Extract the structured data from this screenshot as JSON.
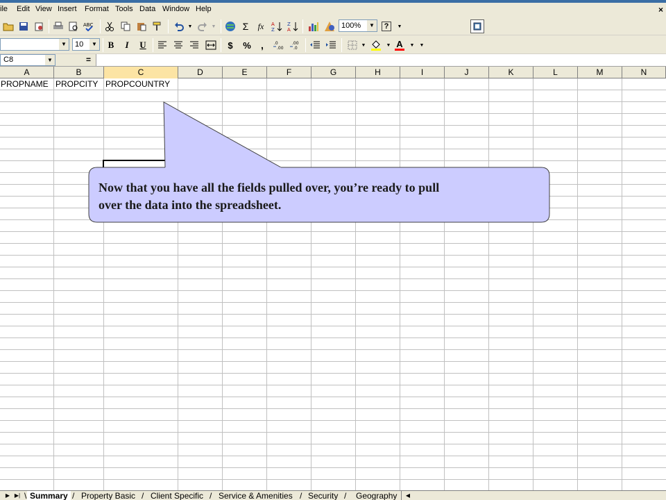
{
  "menubar": {
    "items": [
      {
        "pre": "",
        "u": "F",
        "post": "ile",
        "display": "ile"
      },
      {
        "label": "Edit"
      },
      {
        "label": "View"
      },
      {
        "label": "Insert"
      },
      {
        "label": "Format"
      },
      {
        "label": "Tools"
      },
      {
        "label": "Data"
      },
      {
        "label": "Window"
      },
      {
        "label": "Help"
      }
    ],
    "close_label": "×"
  },
  "toolbar1": {
    "zoom": "100%",
    "help_label": "?"
  },
  "toolbar2": {
    "font_size": "10",
    "bold_label": "B",
    "italic_label": "I",
    "underline_label": "U",
    "currency_label": "$",
    "percent_label": "%",
    "comma_label": ",",
    "font_color_label": "A",
    "fill_color": "#ffff00",
    "font_color": "#ff0000"
  },
  "formula_bar": {
    "name_box": "C8",
    "equals": "="
  },
  "columns": [
    "A",
    "B",
    "C",
    "D",
    "E",
    "F",
    "G",
    "H",
    "I",
    "J",
    "K",
    "L",
    "M",
    "N"
  ],
  "cells": {
    "A1": "PROPNAME",
    "B1": "PROPCITY",
    "C1": "PROPCOUNTRY"
  },
  "callout": {
    "line1": "Now that you have all the fields pulled over, you’re ready to pull",
    "line2": "over the data into the spreadsheet.",
    "fill": "#ccccff"
  },
  "sheet_tabs": [
    "Summary",
    "Property Basic",
    "Client Specific",
    "Service & Amenities",
    "Security",
    "Geography"
  ],
  "active_sheet": "Summary"
}
